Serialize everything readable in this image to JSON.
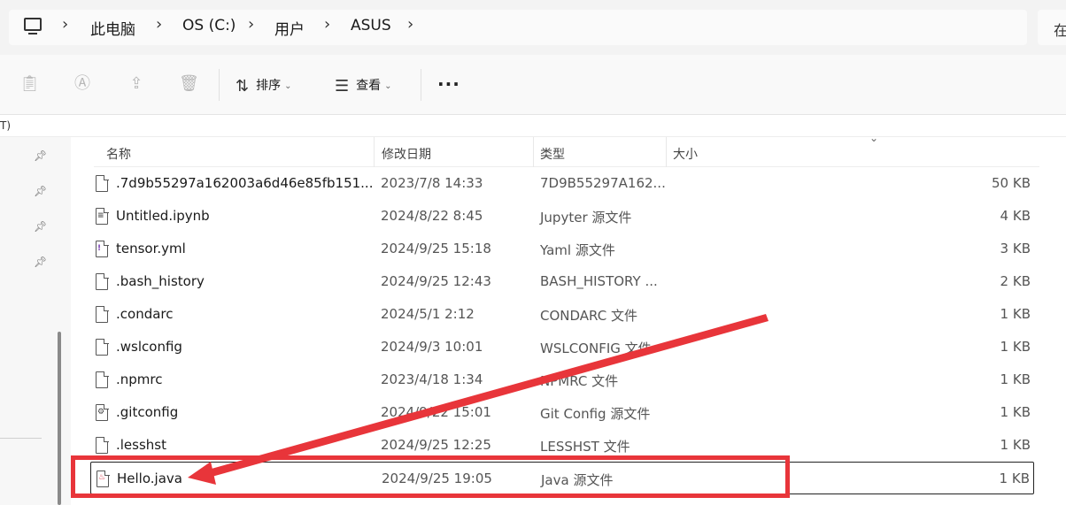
{
  "breadcrumb": {
    "items": [
      "此电脑",
      "OS (C:)",
      "用户",
      "ASUS"
    ],
    "search_glyph": "在"
  },
  "toolbar": {
    "sort_label": "排序",
    "view_label": "查看",
    "more_label": "···",
    "disabled_icons": [
      "clipboard-icon",
      "rename-icon",
      "share-icon",
      "delete-icon"
    ]
  },
  "strip": {
    "text": "T)"
  },
  "columns": {
    "name": "名称",
    "date": "修改日期",
    "type": "类型",
    "size": "大小"
  },
  "files": [
    {
      "name": ".7d9b55297a162003a6d46e85fb151...",
      "date": "2023/7/8 14:33",
      "type": "7D9B55297A162...",
      "size": "50 KB",
      "icon": "file-icon"
    },
    {
      "name": "Untitled.ipynb",
      "date": "2024/8/22 8:45",
      "type": "Jupyter 源文件",
      "size": "4 KB",
      "icon": "notebook-file-icon"
    },
    {
      "name": "tensor.yml",
      "date": "2024/9/25 15:18",
      "type": "Yaml 源文件",
      "size": "3 KB",
      "icon": "yaml-file-icon"
    },
    {
      "name": ".bash_history",
      "date": "2024/9/25 12:43",
      "type": "BASH_HISTORY ...",
      "size": "2 KB",
      "icon": "file-icon"
    },
    {
      "name": ".condarc",
      "date": "2024/5/1 2:12",
      "type": "CONDARC 文件",
      "size": "1 KB",
      "icon": "file-icon"
    },
    {
      "name": ".wslconfig",
      "date": "2024/9/3 10:01",
      "type": "WSLCONFIG 文件",
      "size": "1 KB",
      "icon": "file-icon"
    },
    {
      "name": ".npmrc",
      "date": "2023/4/18 1:34",
      "type": "NPMRC 文件",
      "size": "1 KB",
      "icon": "file-icon"
    },
    {
      "name": ".gitconfig",
      "date": "2024/9/22 15:01",
      "type": "Git Config 源文件",
      "size": "1 KB",
      "icon": "config-file-icon"
    },
    {
      "name": ".lesshst",
      "date": "2024/9/25 12:25",
      "type": "LESSHST 文件",
      "size": "1 KB",
      "icon": "file-icon"
    },
    {
      "name": "Hello.java",
      "date": "2024/9/25 19:05",
      "type": "Java 源文件",
      "size": "1 KB",
      "icon": "java-file-icon"
    }
  ],
  "annotation": {
    "color": "#e8353a",
    "highlighted_file": "Hello.java"
  }
}
